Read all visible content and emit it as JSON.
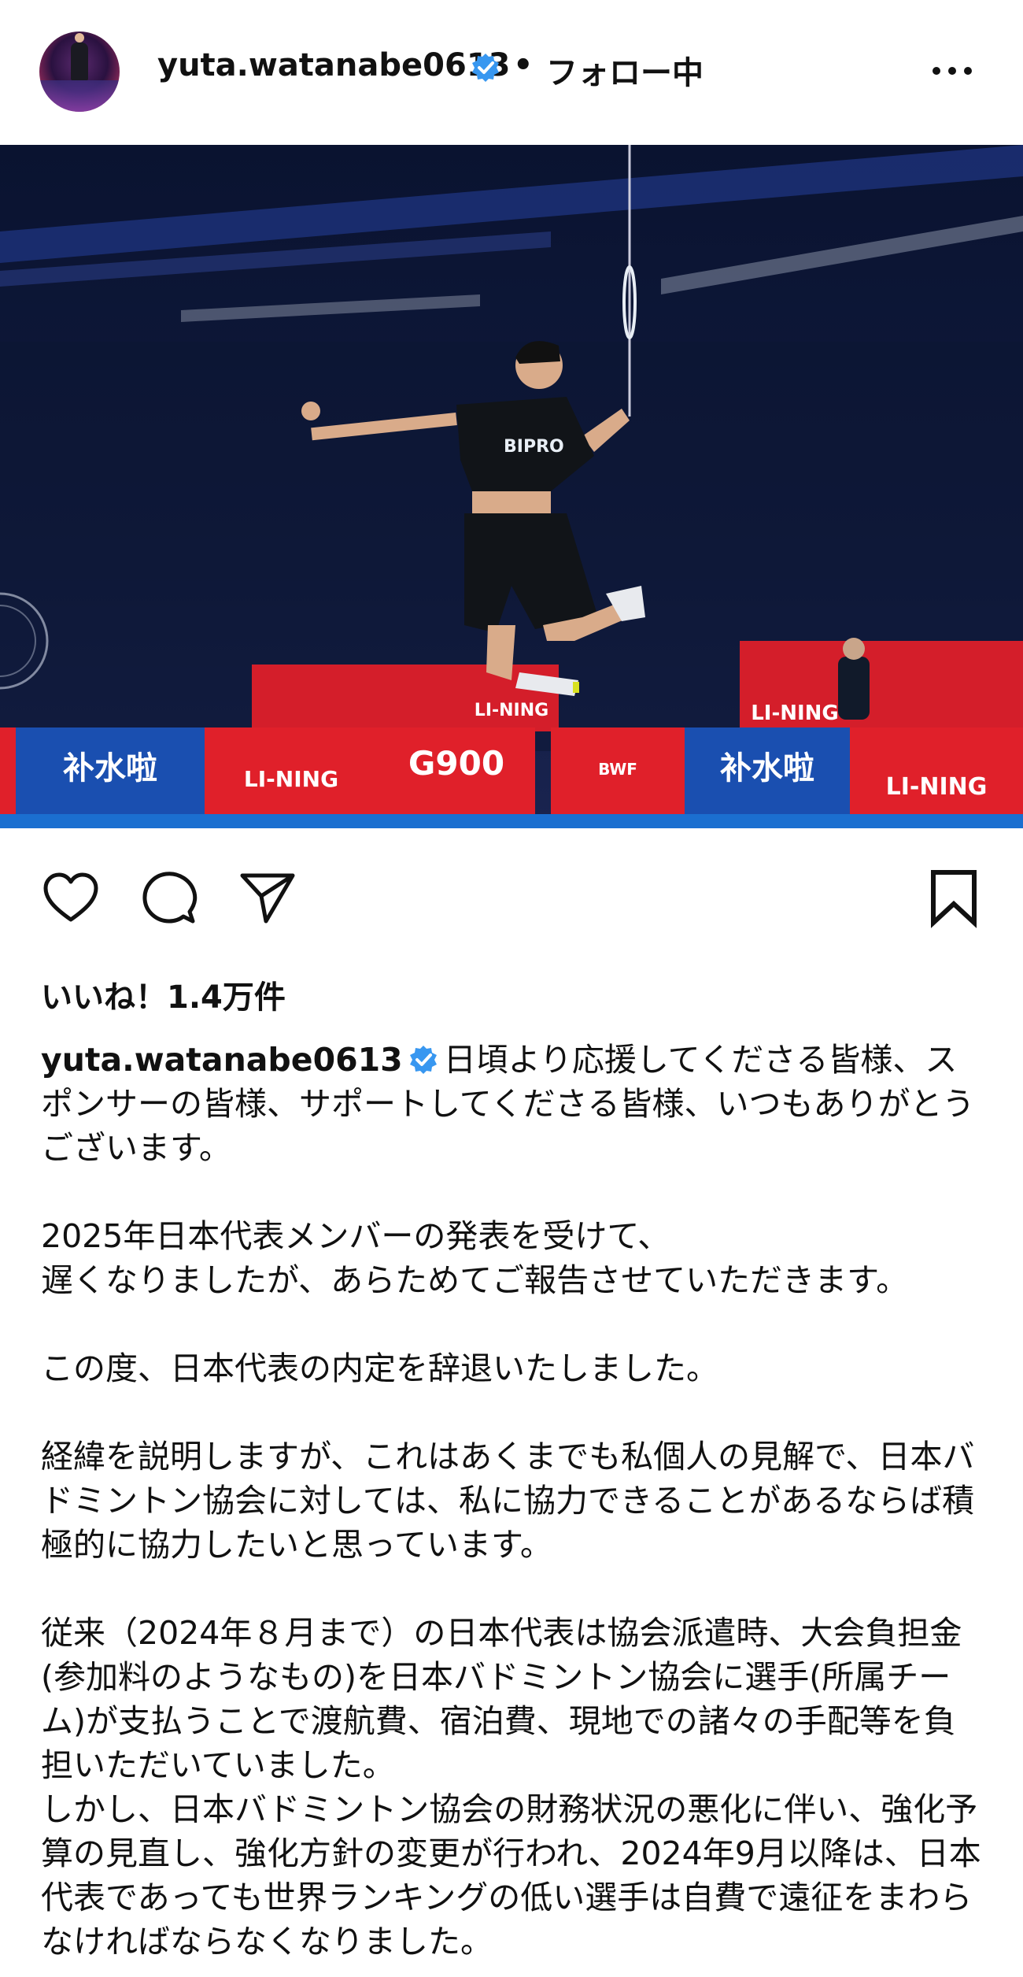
{
  "header": {
    "username": "yuta.watanabe0613",
    "separator": "•",
    "follow_status": "フォロー中"
  },
  "post": {
    "image_banners": [
      "补水啦",
      "LI-NING",
      "G900",
      "BWF",
      "补水啦",
      "LI-NING",
      "LI-NING",
      "LI-NING"
    ],
    "jersey_text": "BIPRO"
  },
  "actions": {
    "like_icon": "heart-icon",
    "comment_icon": "comment-icon",
    "share_icon": "send-icon",
    "save_icon": "bookmark-icon"
  },
  "likes": "いいね！1.4万件",
  "caption": {
    "username": "yuta.watanabe0613",
    "text": "日頃より応援してくださる皆様、スポンサーの皆様、サポートしてくださる皆様、いつもありがとうございます。\n\n2025年日本代表メンバーの発表を受けて、\n遅くなりましたが、あらためてご報告させていただきます。\n\nこの度、日本代表の内定を辞退いたしました。\n\n経緯を説明しますが、これはあくまでも私個人の見解で、日本バドミントン協会に対しては、私に協力できることがあるならば積極的に協力したいと思っています。\n\n従来（2024年８月まで）の日本代表は協会派遣時、大会負担金(参加料のようなもの)を日本バドミントン協会に選手(所属チーム)が支払うことで渡航費、宿泊費、現地での諸々の手配等を負担いただいていました。\nしかし、日本バドミントン協会の財務状況の悪化に伴い、強化予算の見直し、強化方針の変更が行われ、2024年9月以降は、日本代表であっても世界ランキングの低い選手は自費で遠征をまわらなければならなくなりました。"
  },
  "colors": {
    "verified": "#3897f0",
    "text": "#111111",
    "arena_dark": "#0c1430",
    "banner_red": "#e0202a",
    "banner_blue": "#1a4fb0"
  }
}
